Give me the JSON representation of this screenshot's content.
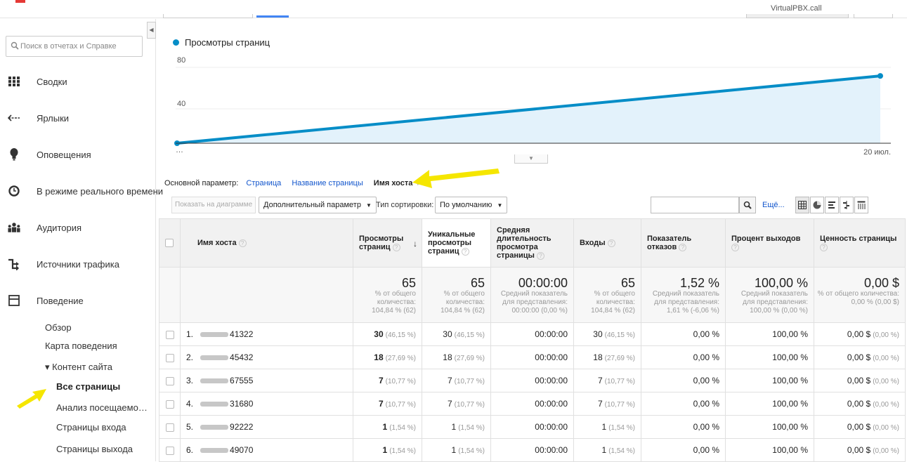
{
  "topbar": {
    "account": "VirtualPBX.call"
  },
  "sidebar": {
    "search_placeholder": "Поиск в отчетах и Справке",
    "items": [
      {
        "label": "Сводки",
        "icon": "grid-icon"
      },
      {
        "label": "Ярлыки",
        "icon": "shortcut-arrow-icon"
      },
      {
        "label": "Оповещения",
        "icon": "bulb-icon"
      },
      {
        "label": "В режиме реального времени",
        "icon": "clock-icon"
      },
      {
        "label": "Аудитория",
        "icon": "users-icon"
      },
      {
        "label": "Источники трафика",
        "icon": "acquisition-icon"
      },
      {
        "label": "Поведение",
        "icon": "behavior-icon"
      }
    ],
    "sub_items": {
      "overview": "Обзор",
      "behavior_flow": "Карта поведения",
      "site_content": "▾ Контент сайта",
      "all_pages": "Все страницы",
      "content_drilldown": "Анализ посещаемо…",
      "landing_pages": "Страницы входа",
      "exit_pages": "Страницы выхода"
    }
  },
  "chart_data": {
    "type": "line",
    "series": [
      {
        "name": "Просмотры страниц",
        "x": [
          "…",
          "20 июл."
        ],
        "values": [
          0,
          65
        ]
      }
    ],
    "yticks": [
      "80",
      "40"
    ],
    "xtick_labels": [
      "…",
      "20 июл."
    ],
    "ylim": [
      0,
      80
    ],
    "color": "#058dc7"
  },
  "dimension": {
    "label": "Основной параметр:",
    "options": [
      "Страница",
      "Название страницы"
    ],
    "current": "Имя хоста"
  },
  "toolbar": {
    "plot_rows": "Показать на диаграмме",
    "secondary": "Дополнительный параметр",
    "sort_label": "Тип сортировки:",
    "sort_value": "По умолчанию",
    "more": "Ещё..."
  },
  "table": {
    "headers": {
      "host": "Имя хоста",
      "pageviews": "Просмотры страниц",
      "unique": "Уникальные просмотры страниц",
      "avg_time": "Средняя длительность просмотра страницы",
      "entrances": "Входы",
      "bounce": "Показатель отказов",
      "exit": "Процент выходов",
      "value": "Ценность страницы"
    },
    "totals": {
      "pageviews": {
        "big": "65",
        "sub": "% от общего количества: 104,84 % (62)"
      },
      "unique": {
        "big": "65",
        "sub": "% от общего количества: 104,84 % (62)"
      },
      "avg_time": {
        "big": "00:00:00",
        "sub": "Средний показатель для представления: 00:00:00 (0,00 %)"
      },
      "entrances": {
        "big": "65",
        "sub": "% от общего количества: 104,84 % (62)"
      },
      "bounce": {
        "big": "1,52 %",
        "sub": "Средний показатель для представления: 1,61 % (-6,06 %)"
      },
      "exit": {
        "big": "100,00 %",
        "sub": "Средний показатель для представления: 100,00 % (0,00 %)"
      },
      "value": {
        "big": "0,00 $",
        "sub": "% от общего количества: 0,00 % (0,00 $)"
      }
    },
    "rows": [
      {
        "idx": "1.",
        "host_suffix": "41322",
        "pv": "30",
        "pv_pct": "(46,15 %)",
        "upv": "30",
        "upv_pct": "(46,15 %)",
        "time": "00:00:00",
        "ent": "30",
        "ent_pct": "(46,15 %)",
        "bounce": "0,00 %",
        "exit": "100,00 %",
        "val": "0,00 $",
        "val_pct": "(0,00 %)"
      },
      {
        "idx": "2.",
        "host_suffix": "45432",
        "pv": "18",
        "pv_pct": "(27,69 %)",
        "upv": "18",
        "upv_pct": "(27,69 %)",
        "time": "00:00:00",
        "ent": "18",
        "ent_pct": "(27,69 %)",
        "bounce": "0,00 %",
        "exit": "100,00 %",
        "val": "0,00 $",
        "val_pct": "(0,00 %)"
      },
      {
        "idx": "3.",
        "host_suffix": "67555",
        "pv": "7",
        "pv_pct": "(10,77 %)",
        "upv": "7",
        "upv_pct": "(10,77 %)",
        "time": "00:00:00",
        "ent": "7",
        "ent_pct": "(10,77 %)",
        "bounce": "0,00 %",
        "exit": "100,00 %",
        "val": "0,00 $",
        "val_pct": "(0,00 %)"
      },
      {
        "idx": "4.",
        "host_suffix": "31680",
        "pv": "7",
        "pv_pct": "(10,77 %)",
        "upv": "7",
        "upv_pct": "(10,77 %)",
        "time": "00:00:00",
        "ent": "7",
        "ent_pct": "(10,77 %)",
        "bounce": "0,00 %",
        "exit": "100,00 %",
        "val": "0,00 $",
        "val_pct": "(0,00 %)"
      },
      {
        "idx": "5.",
        "host_suffix": "92222",
        "pv": "1",
        "pv_pct": "(1,54 %)",
        "upv": "1",
        "upv_pct": "(1,54 %)",
        "time": "00:00:00",
        "ent": "1",
        "ent_pct": "(1,54 %)",
        "bounce": "0,00 %",
        "exit": "100,00 %",
        "val": "0,00 $",
        "val_pct": "(0,00 %)"
      },
      {
        "idx": "6.",
        "host_suffix": "49070",
        "pv": "1",
        "pv_pct": "(1,54 %)",
        "upv": "1",
        "upv_pct": "(1,54 %)",
        "time": "00:00:00",
        "ent": "1",
        "ent_pct": "(1,54 %)",
        "bounce": "0,00 %",
        "exit": "100,00 %",
        "val": "0,00 $",
        "val_pct": "(0,00 %)"
      }
    ]
  },
  "colors": {
    "accent": "#058dc7",
    "link": "#1155cc",
    "highlight_arrow": "#f5e600"
  }
}
